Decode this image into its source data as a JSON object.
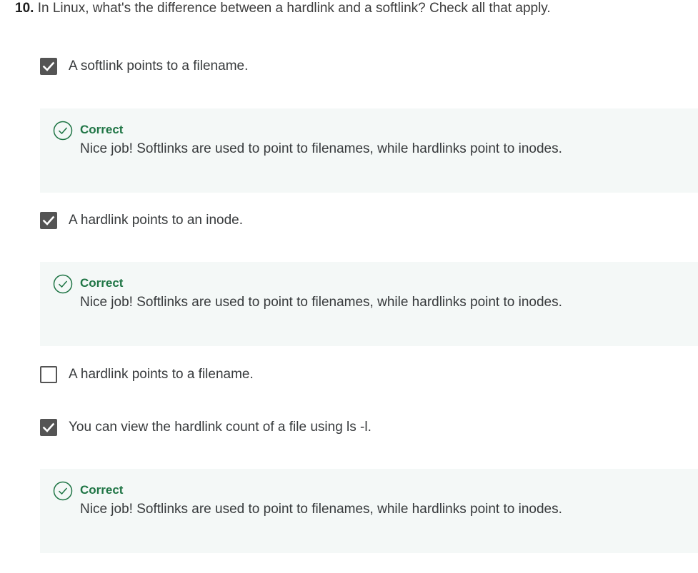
{
  "question": {
    "number": "10.",
    "text": "In Linux, what's the difference between a hardlink and a softlink? Check all that apply."
  },
  "options": [
    {
      "label": "A softlink points to a filename.",
      "checked": true,
      "feedback": {
        "status": "Correct",
        "message": "Nice job! Softlinks are used to point to filenames, while hardlinks point to inodes."
      }
    },
    {
      "label": "A hardlink points to an inode.",
      "checked": true,
      "feedback": {
        "status": "Correct",
        "message": "Nice job! Softlinks are used to point to filenames, while hardlinks point to inodes."
      }
    },
    {
      "label": "A hardlink points to a filename.",
      "checked": false
    },
    {
      "label": "You can view the hardlink count of a file using ls -l.",
      "checked": true,
      "feedback": {
        "status": "Correct",
        "message": "Nice job! Softlinks are used to point to filenames, while hardlinks point to inodes."
      }
    }
  ],
  "colors": {
    "correct_green": "#1f7545",
    "checkbox_fill": "#545454",
    "feedback_bg": "#f4f8f7"
  },
  "icons": {
    "checkbox_checked": "checkmark-icon",
    "feedback_correct": "check-circle-icon"
  }
}
